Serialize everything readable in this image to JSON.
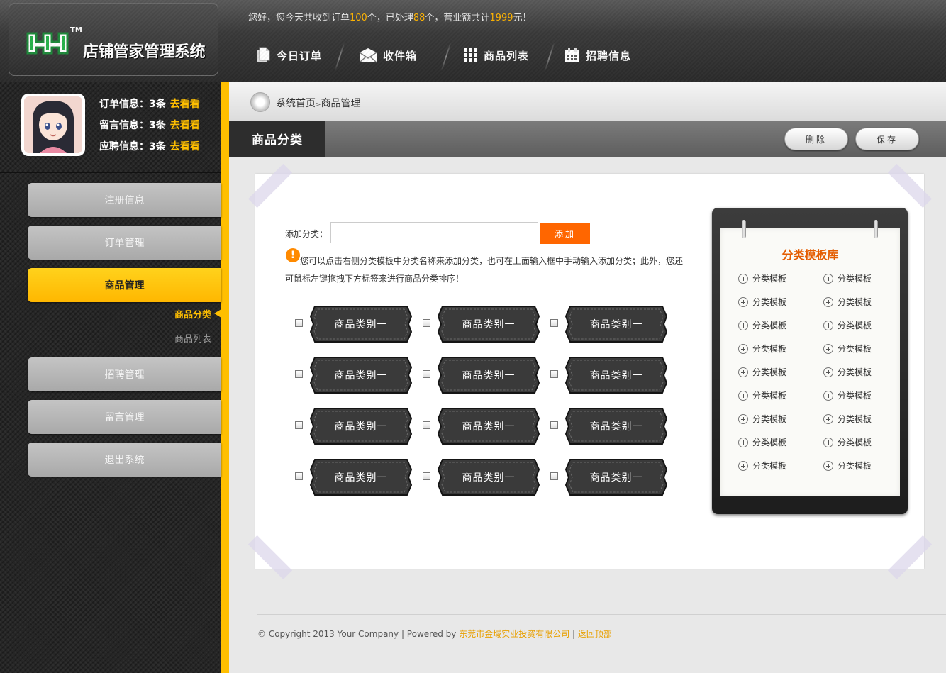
{
  "header": {
    "logo_text": "店铺管家管理系统",
    "logo_tm": "TM",
    "welcome": {
      "p1": "您好，您今天共收到订单",
      "orders": "100",
      "p2": "个，已处理",
      "processed": "88",
      "p3": "个，营业额共计",
      "revenue": "1999",
      "p4": "元！"
    },
    "nav": [
      {
        "label": "今日订单",
        "icon": "document-icon"
      },
      {
        "label": "收件箱",
        "icon": "envelope-icon"
      },
      {
        "label": "商品列表",
        "icon": "grid-icon"
      },
      {
        "label": "招聘信息",
        "icon": "calendar-icon"
      }
    ]
  },
  "user": {
    "lines": [
      {
        "label": "订单信息：",
        "count": "3条",
        "link": "去看看"
      },
      {
        "label": "留言信息：",
        "count": "3条",
        "link": "去看看"
      },
      {
        "label": "应聘信息：",
        "count": "3条",
        "link": "去看看"
      }
    ]
  },
  "sidebar": {
    "items": [
      {
        "label": "注册信息",
        "active": false
      },
      {
        "label": "订单管理",
        "active": false
      },
      {
        "label": "商品管理",
        "active": true
      },
      {
        "label": "招聘管理",
        "active": false
      },
      {
        "label": "留言管理",
        "active": false
      },
      {
        "label": "退出系统",
        "active": false
      }
    ],
    "subitems": [
      {
        "label": "商品分类",
        "active": true
      },
      {
        "label": "商品列表",
        "active": false
      }
    ]
  },
  "breadcrumb": {
    "home": "系统首页",
    "sep": ">",
    "current": "商品管理"
  },
  "section": {
    "title": "商品分类",
    "delete_label": "删除",
    "save_label": "保存"
  },
  "form": {
    "add_label": "添加分类：",
    "input_value": "",
    "add_button": "添加",
    "tip": "您可以点击右侧分类模板中分类名称来添加分类，也可在上面输入框中手动输入添加分类；此外，您还可鼠标左键拖拽下方标签来进行商品分类排序！"
  },
  "categories": [
    "商品类别一",
    "商品类别一",
    "商品类别一",
    "商品类别一",
    "商品类别一",
    "商品类别一",
    "商品类别一",
    "商品类别一",
    "商品类别一",
    "商品类别一",
    "商品类别一",
    "商品类别一"
  ],
  "library": {
    "title": "分类模板库",
    "items": [
      "分类模板",
      "分类模板",
      "分类模板",
      "分类模板",
      "分类模板",
      "分类模板",
      "分类模板",
      "分类模板",
      "分类模板",
      "分类模板",
      "分类模板",
      "分类模板",
      "分类模板",
      "分类模板",
      "分类模板",
      "分类模板",
      "分类模板",
      "分类模板"
    ]
  },
  "footer": {
    "copyright": "© Copyright 2013 Your Company | Powered by ",
    "company": "东莞市金域实业投资有限公司",
    "sep": " | ",
    "back_top": "返回顶部"
  },
  "colors": {
    "accent": "#ffbf00",
    "orange": "#ff6600",
    "library_title": "#e45c00"
  }
}
